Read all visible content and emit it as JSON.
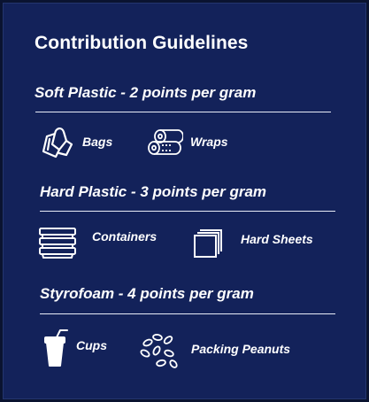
{
  "panel": {
    "title": "Contribution Guidelines"
  },
  "sections": [
    {
      "heading": "Soft Plastic - 2 points per gram",
      "items": [
        {
          "label": "Bags",
          "icon": "plastic-bag-icon"
        },
        {
          "label": "Wraps",
          "icon": "wrap-rolls-icon"
        }
      ]
    },
    {
      "heading": "Hard Plastic - 3 points per gram",
      "items": [
        {
          "label": "Containers",
          "icon": "stacked-containers-icon"
        },
        {
          "label": "Hard Sheets",
          "icon": "stacked-sheets-icon"
        }
      ]
    },
    {
      "heading": "Styrofoam - 4 points per gram",
      "items": [
        {
          "label": "Cups",
          "icon": "cup-with-straw-icon"
        },
        {
          "label": "Packing Peanuts",
          "icon": "packing-peanuts-icon"
        }
      ]
    }
  ],
  "colors": {
    "background": "#13225a",
    "text": "#ffffff",
    "divider": "#e8ecf7"
  }
}
